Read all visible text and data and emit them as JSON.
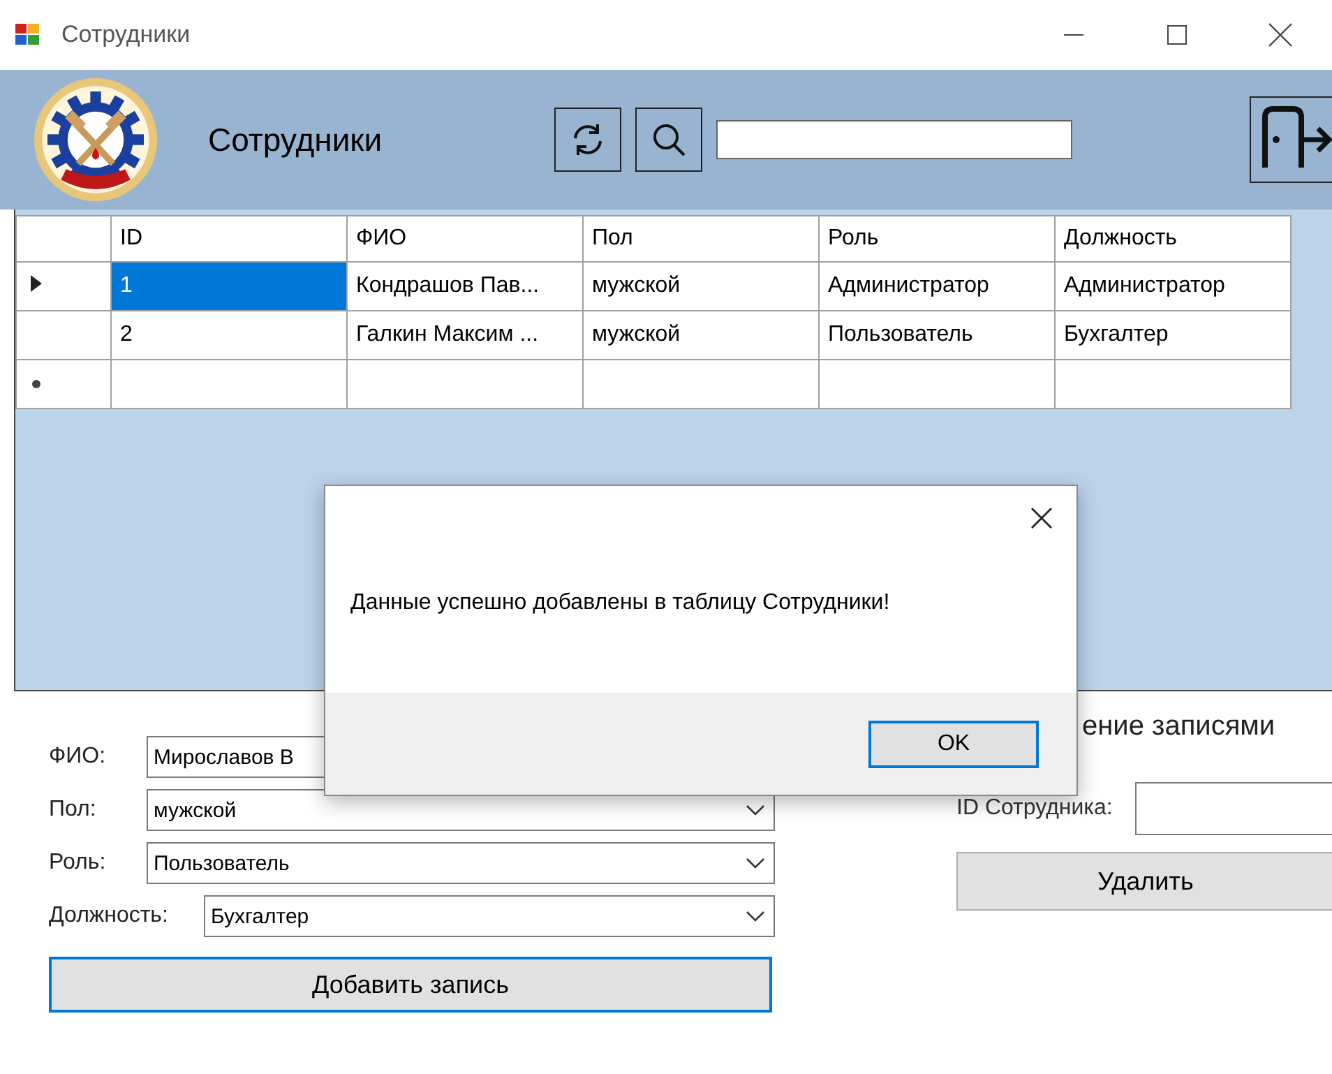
{
  "window": {
    "title": "Сотрудники"
  },
  "header": {
    "title": "Сотрудники"
  },
  "table": {
    "columns": [
      "ID",
      "ФИО",
      "Пол",
      "Роль",
      "Должность"
    ],
    "rows": [
      {
        "kind": "data",
        "selected": true,
        "cells": [
          "1",
          "Кондрашов Пав...",
          "мужской",
          "Администратор",
          "Администратор"
        ]
      },
      {
        "kind": "data",
        "selected": false,
        "cells": [
          "2",
          "Галкин Максим ...",
          "мужской",
          "Пользователь",
          "Бухгалтер"
        ]
      },
      {
        "kind": "new",
        "selected": false,
        "cells": [
          "",
          "",
          "",
          "",
          ""
        ]
      }
    ]
  },
  "add_form": {
    "fields": [
      {
        "kind": "text",
        "label": "ФИО:",
        "value": "Мирославов В"
      },
      {
        "kind": "combo",
        "label": "Пол:",
        "value": "мужской"
      },
      {
        "kind": "combo",
        "label": "Роль:",
        "value": "Пользователь"
      },
      {
        "kind": "combo",
        "label": "Должность:",
        "value": "Бухгалтер"
      }
    ],
    "button": "Добавить запись"
  },
  "delete_panel": {
    "heading": "ение записями",
    "label": "ID Сотрудника:",
    "button": "Удалить"
  },
  "dialog": {
    "message": "Данные успешно добавлены в таблицу Сотрудники!",
    "button": "OK"
  }
}
